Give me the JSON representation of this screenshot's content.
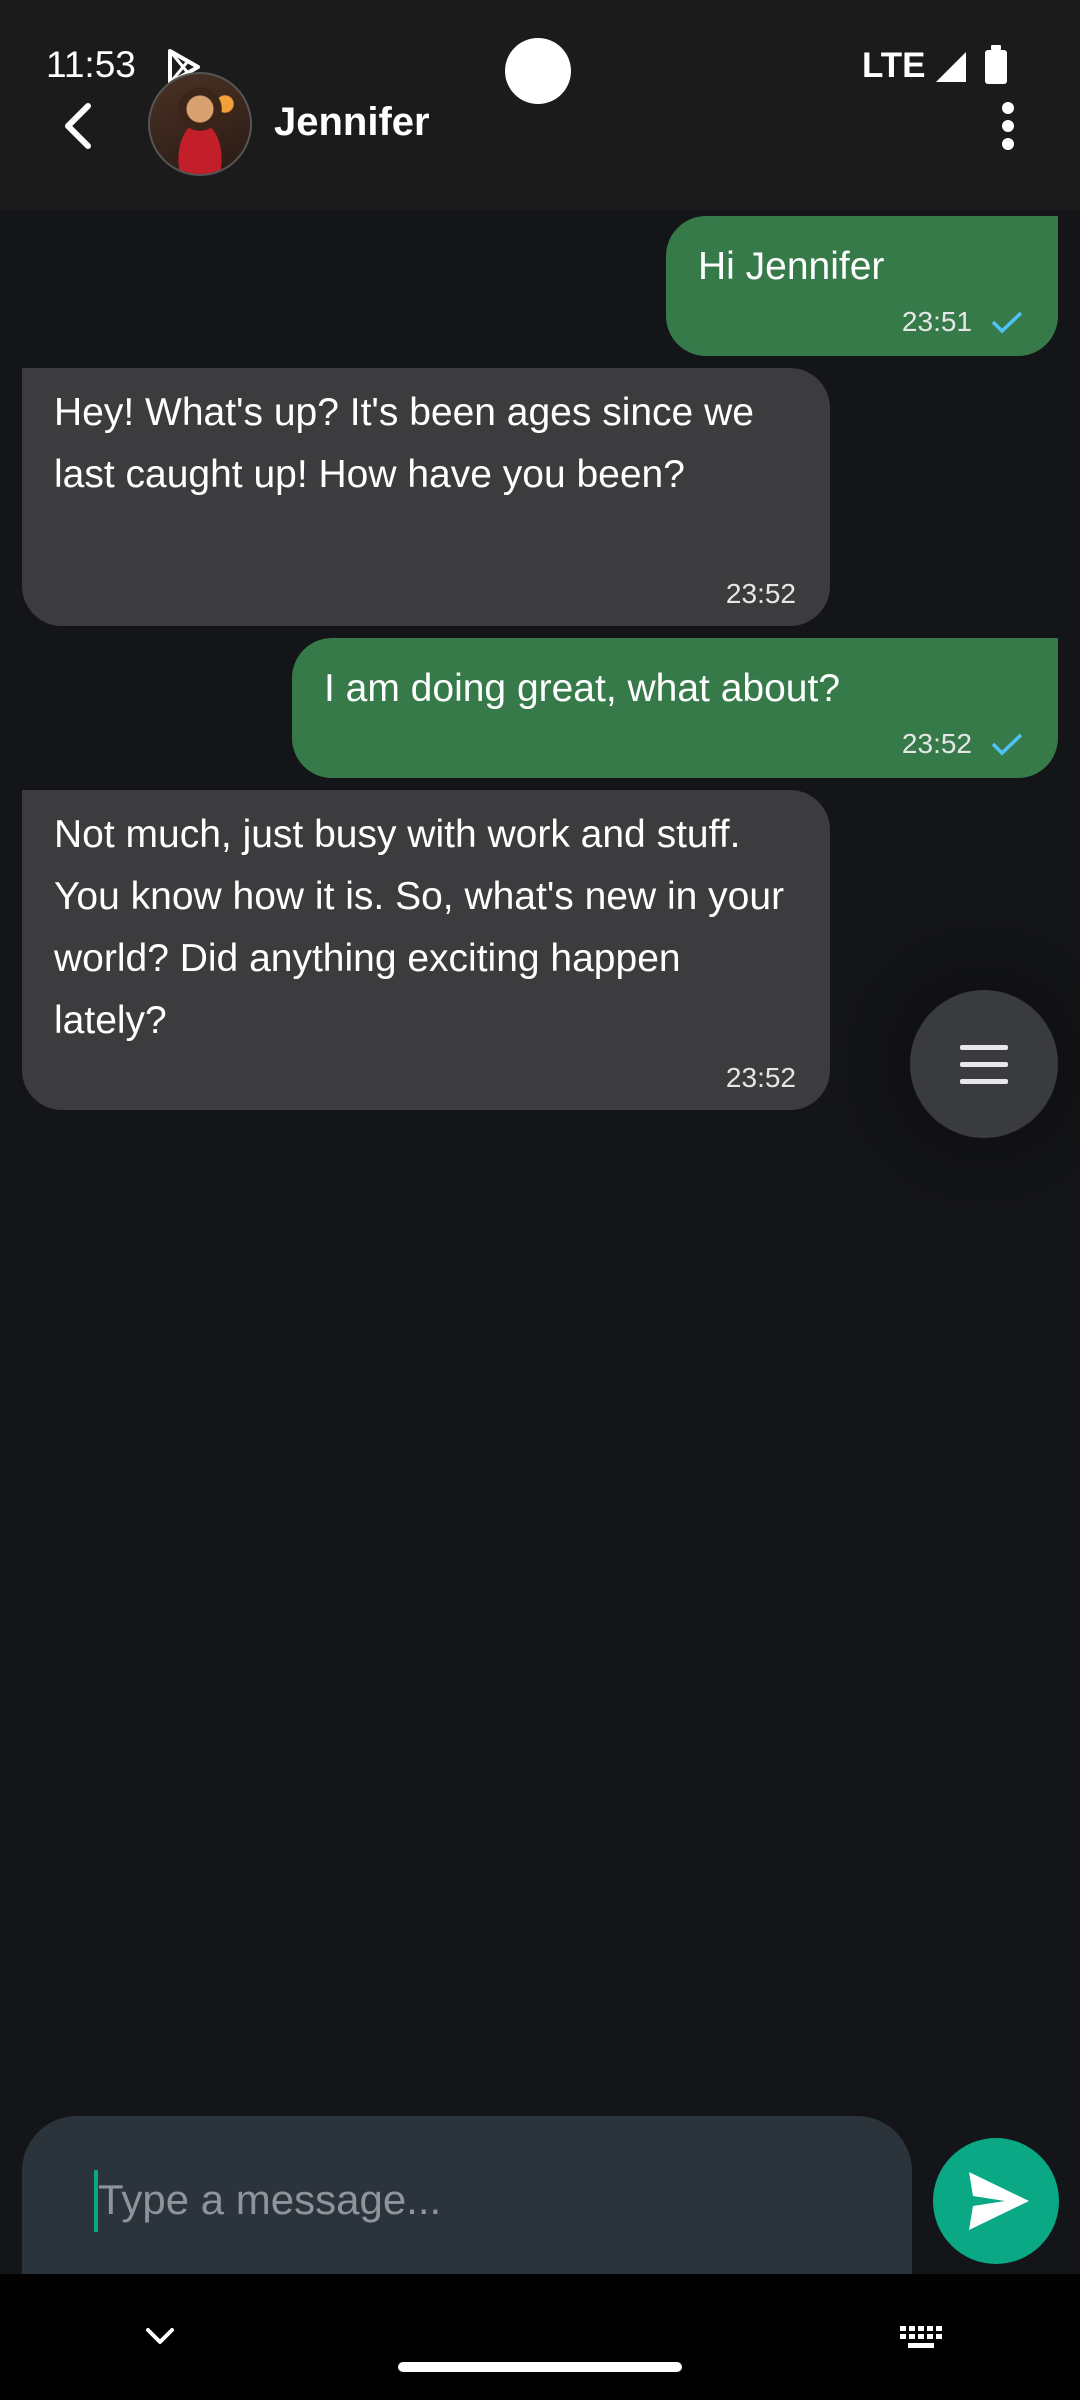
{
  "status_bar": {
    "time": "11:53",
    "network": "LTE"
  },
  "header": {
    "contact_name": "Jennifer"
  },
  "messages": [
    {
      "direction": "sent",
      "text": "Hi Jennifer",
      "time": "23:51",
      "read": true
    },
    {
      "direction": "received",
      "text": "Hey! What's up? It's been ages since we last caught up! How have you been?",
      "time": "23:52"
    },
    {
      "direction": "sent",
      "text": "I am doing great, what about?",
      "time": "23:52",
      "read": true
    },
    {
      "direction": "received",
      "text": "Not much, just busy with work and stuff. You know how it is. So, what's new in your world? Did anything exciting happen lately?",
      "time": "23:52"
    }
  ],
  "composer": {
    "placeholder": "Type a message...",
    "value": ""
  },
  "colors": {
    "sent_bubble": "#357a48",
    "received_bubble": "#3c3c3e",
    "accent": "#0aa884",
    "read_check": "#4fc3f7"
  },
  "icons": {
    "back": "arrow-back-icon",
    "more": "more-vert-icon",
    "menu": "menu-icon",
    "send": "send-icon",
    "collapse": "chevron-down-icon",
    "keyboard": "keyboard-icon"
  }
}
